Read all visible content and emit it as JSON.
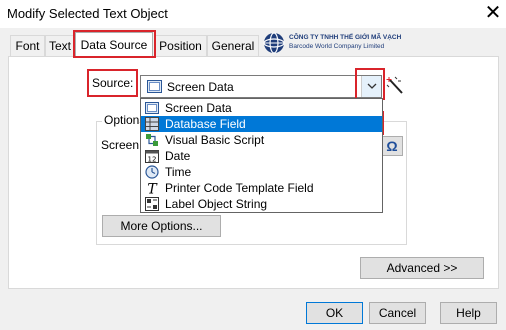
{
  "window": {
    "title": "Modify Selected Text Object",
    "close_glyph": "✕"
  },
  "tabs": [
    {
      "label": "Font"
    },
    {
      "label": "Text"
    },
    {
      "label": "Data Source",
      "active": true
    },
    {
      "label": "Position"
    },
    {
      "label": "General"
    }
  ],
  "logo": {
    "line1": "CÔNG TY TNHH THẾ GIỚI MÃ VẠCH",
    "line2": "Barcode World Company Limited"
  },
  "source": {
    "label": "Source:",
    "selected_value": "Screen Data",
    "selected_icon": "screen-data-icon",
    "magic_icon": "magic-wand-icon"
  },
  "dropdown": {
    "items": [
      {
        "label": "Screen Data",
        "icon": "screen-data-icon"
      },
      {
        "label": "Database Field",
        "icon": "database-field-icon",
        "highlighted": true
      },
      {
        "label": "Visual Basic Script",
        "icon": "vb-script-icon"
      },
      {
        "label": "Date",
        "icon": "calendar-icon"
      },
      {
        "label": "Time",
        "icon": "clock-icon"
      },
      {
        "label": "Printer Code Template Field",
        "icon": "template-t-icon"
      },
      {
        "label": "Label Object String",
        "icon": "label-object-icon"
      }
    ]
  },
  "options": {
    "legend": "Options",
    "screen_label": "Screen D",
    "omega_glyph": "Ω",
    "more_options_label": "More Options..."
  },
  "advanced_label": "Advanced >>",
  "buttons": {
    "ok": "OK",
    "cancel": "Cancel",
    "help": "Help"
  },
  "colors": {
    "highlight_red": "#d9242b",
    "selection_blue": "#0078d7",
    "dialog_gray": "#f0f0f0"
  }
}
